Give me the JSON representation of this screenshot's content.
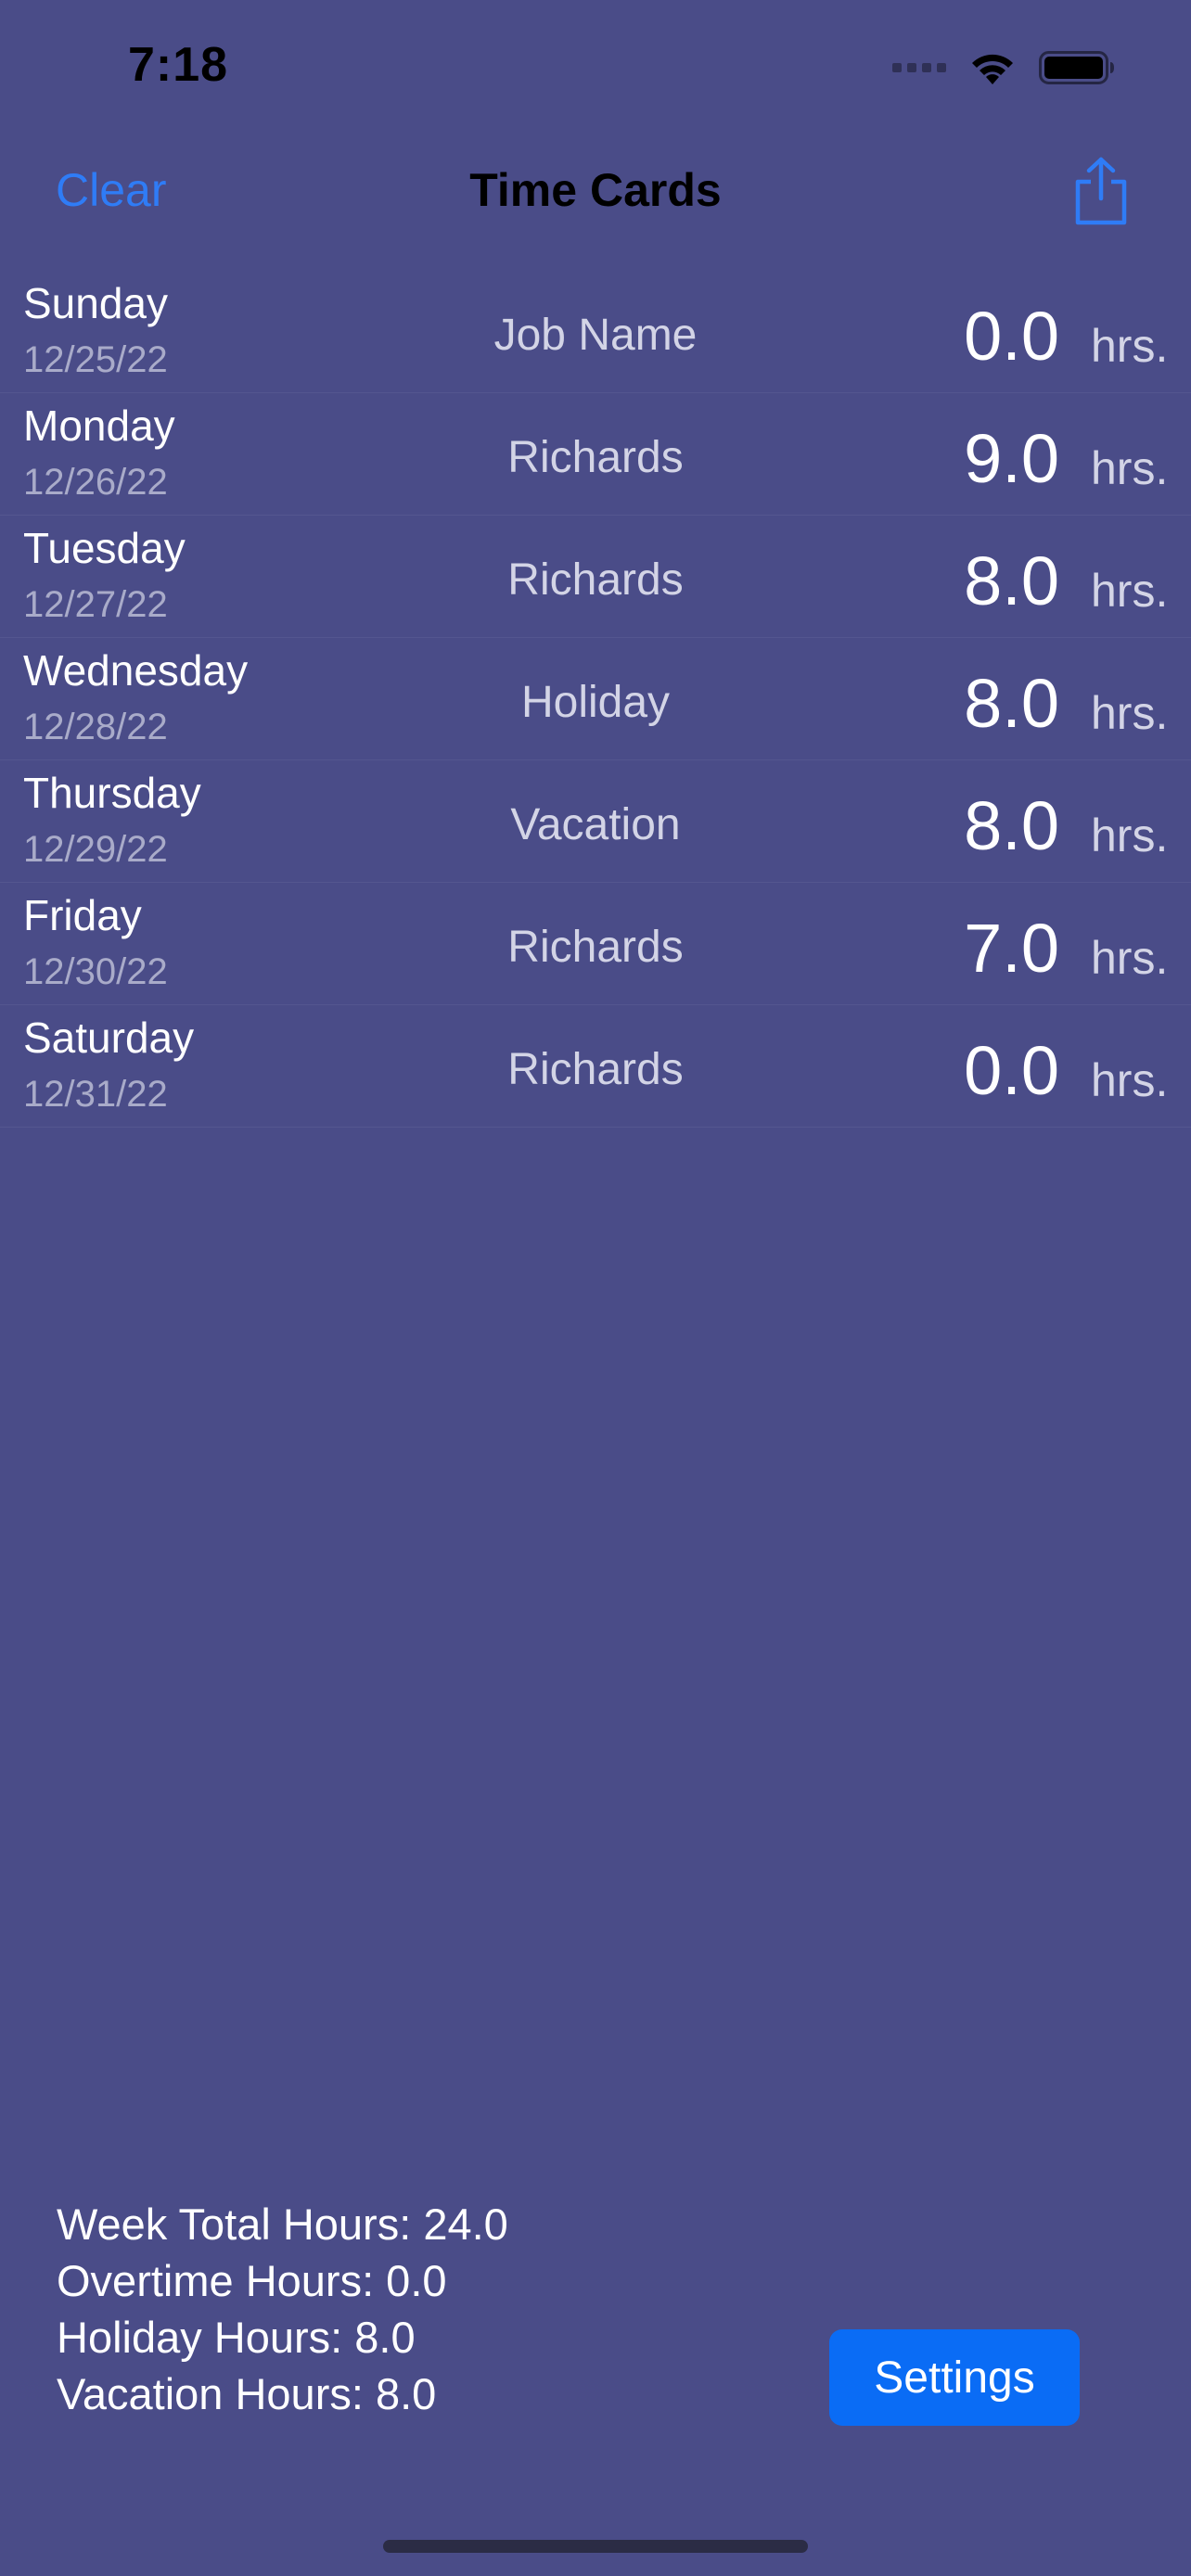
{
  "status_bar": {
    "time": "7:18",
    "icons": [
      "signal-icon",
      "wifi-icon",
      "battery-icon"
    ]
  },
  "nav": {
    "clear_label": "Clear",
    "title": "Time Cards",
    "share_icon": "share-icon"
  },
  "days": [
    {
      "day": "Sunday",
      "date": "12/25/22",
      "job": "Job Name",
      "hours": "0.0",
      "unit": "hrs."
    },
    {
      "day": "Monday",
      "date": "12/26/22",
      "job": "Richards",
      "hours": "9.0",
      "unit": "hrs."
    },
    {
      "day": "Tuesday",
      "date": "12/27/22",
      "job": "Richards",
      "hours": "8.0",
      "unit": "hrs."
    },
    {
      "day": "Wednesday",
      "date": "12/28/22",
      "job": "Holiday",
      "hours": "8.0",
      "unit": "hrs."
    },
    {
      "day": "Thursday",
      "date": "12/29/22",
      "job": "Vacation",
      "hours": "8.0",
      "unit": "hrs."
    },
    {
      "day": "Friday",
      "date": "12/30/22",
      "job": "Richards",
      "hours": "7.0",
      "unit": "hrs."
    },
    {
      "day": "Saturday",
      "date": "12/31/22",
      "job": "Richards",
      "hours": "0.0",
      "unit": "hrs."
    }
  ],
  "summary": {
    "week_total": "Week Total Hours: 24.0",
    "overtime": "Overtime Hours: 0.0",
    "holiday": "Holiday Hours: 8.0",
    "vacation": "Vacation Hours: 8.0"
  },
  "settings_label": "Settings",
  "colors": {
    "background": "#4a4c88",
    "accent": "#2f7cf6",
    "button": "#0a6cf5"
  }
}
